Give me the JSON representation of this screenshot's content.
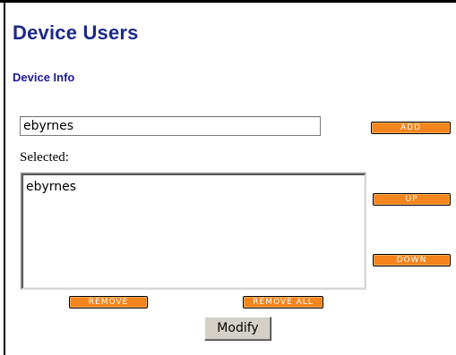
{
  "page": {
    "title": "Device Users",
    "section": "Device Info"
  },
  "user_input": {
    "value": "ebyrnes"
  },
  "selected": {
    "label": "Selected:",
    "items": [
      "ebyrnes"
    ]
  },
  "buttons": {
    "add": "ADD",
    "up": "UP",
    "down": "DOWN",
    "remove": "REMOVE",
    "remove_all": "REMOVE ALL",
    "modify": "Modify"
  },
  "colors": {
    "title": "#1c2a8a",
    "button_orange": "#f4841c"
  }
}
